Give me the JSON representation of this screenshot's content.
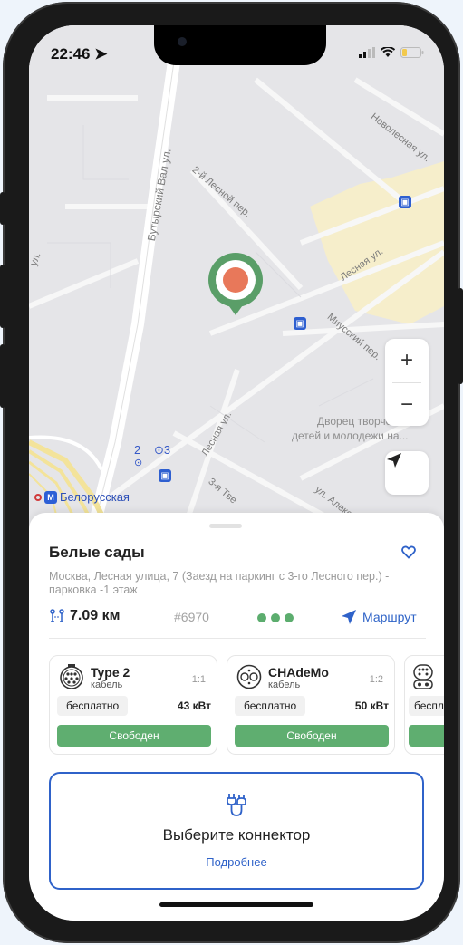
{
  "status_bar": {
    "time": "22:46"
  },
  "map": {
    "street_labels": [
      "Новолесная ул.",
      "2-й Лесной пер.",
      "Бутырский Вал ул.",
      "Лесная ул.",
      "Миусский пер.",
      "Лесная ул.",
      "3-я Тве",
      "ул. Алекс",
      "ул."
    ],
    "poi_label_1": "Дворец творчества",
    "poi_label_2": "детей и молодежи на...",
    "metro_station": "Белорусская",
    "cluster_left": "2",
    "cluster_right": "3",
    "zoom_in": "+",
    "zoom_out": "−",
    "marker_color": "#5a9e68",
    "marker_dot_color": "#e8785a"
  },
  "station": {
    "title": "Белые сады",
    "address": "Москва, Лесная улица, 7 (Заезд на паркинг с 3-го Лесного пер.) - парковка -1 этаж",
    "distance": "7.09 км",
    "id": "#6970",
    "route_label": "Маршрут"
  },
  "connectors": [
    {
      "name": "Type 2",
      "sub": "кабель",
      "index": "1:1",
      "price": "бесплатно",
      "power": "43 кВт",
      "status": "Свободен"
    },
    {
      "name": "CHAdeMo",
      "sub": "кабель",
      "index": "1:2",
      "price": "бесплатно",
      "power": "50 кВт",
      "status": "Свободен"
    },
    {
      "name": "",
      "sub": "",
      "index": "",
      "price": "беспл",
      "power": "",
      "status": ""
    }
  ],
  "select_box": {
    "title": "Выберите коннектор",
    "link": "Подробнее"
  },
  "colors": {
    "accent_blue": "#2f62c9",
    "status_green": "#5fae70"
  }
}
